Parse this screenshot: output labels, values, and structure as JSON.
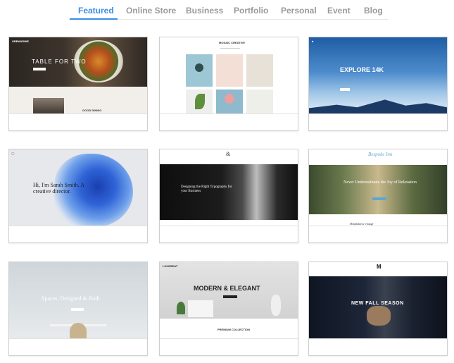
{
  "tabs": [
    {
      "label": "Featured",
      "active": true
    },
    {
      "label": "Online Store",
      "active": false
    },
    {
      "label": "Business",
      "active": false
    },
    {
      "label": "Portfolio",
      "active": false
    },
    {
      "label": "Personal",
      "active": false
    },
    {
      "label": "Event",
      "active": false
    },
    {
      "label": "Blog",
      "active": false
    }
  ],
  "accent_color": "#3a8ee0",
  "templates": [
    {
      "name": "URBANDINE",
      "headline": "TABLE FOR TWO",
      "subline": "GOOD DINING"
    },
    {
      "name": "MOSAIC CREATIVE"
    },
    {
      "name": "EXPLORE 14K",
      "headline": "EXPLORE 14K"
    },
    {
      "headline": "Hi, I'm Sarah Smith. A creative director."
    },
    {
      "headline": "Designing the Right Typography for your Business"
    },
    {
      "name": "Bespoke Inn",
      "headline": "Never Underestimate the Joy of Relaxation",
      "subline": "Mindfulness Vintage"
    },
    {
      "headline": "Spaces: Designed & Built"
    },
    {
      "name": "LOVESEAT",
      "headline": "MODERN & ELEGANT",
      "subline": "PREMIUM COLLECTION"
    },
    {
      "name": "M",
      "headline": "NEW FALL SEASON"
    }
  ]
}
